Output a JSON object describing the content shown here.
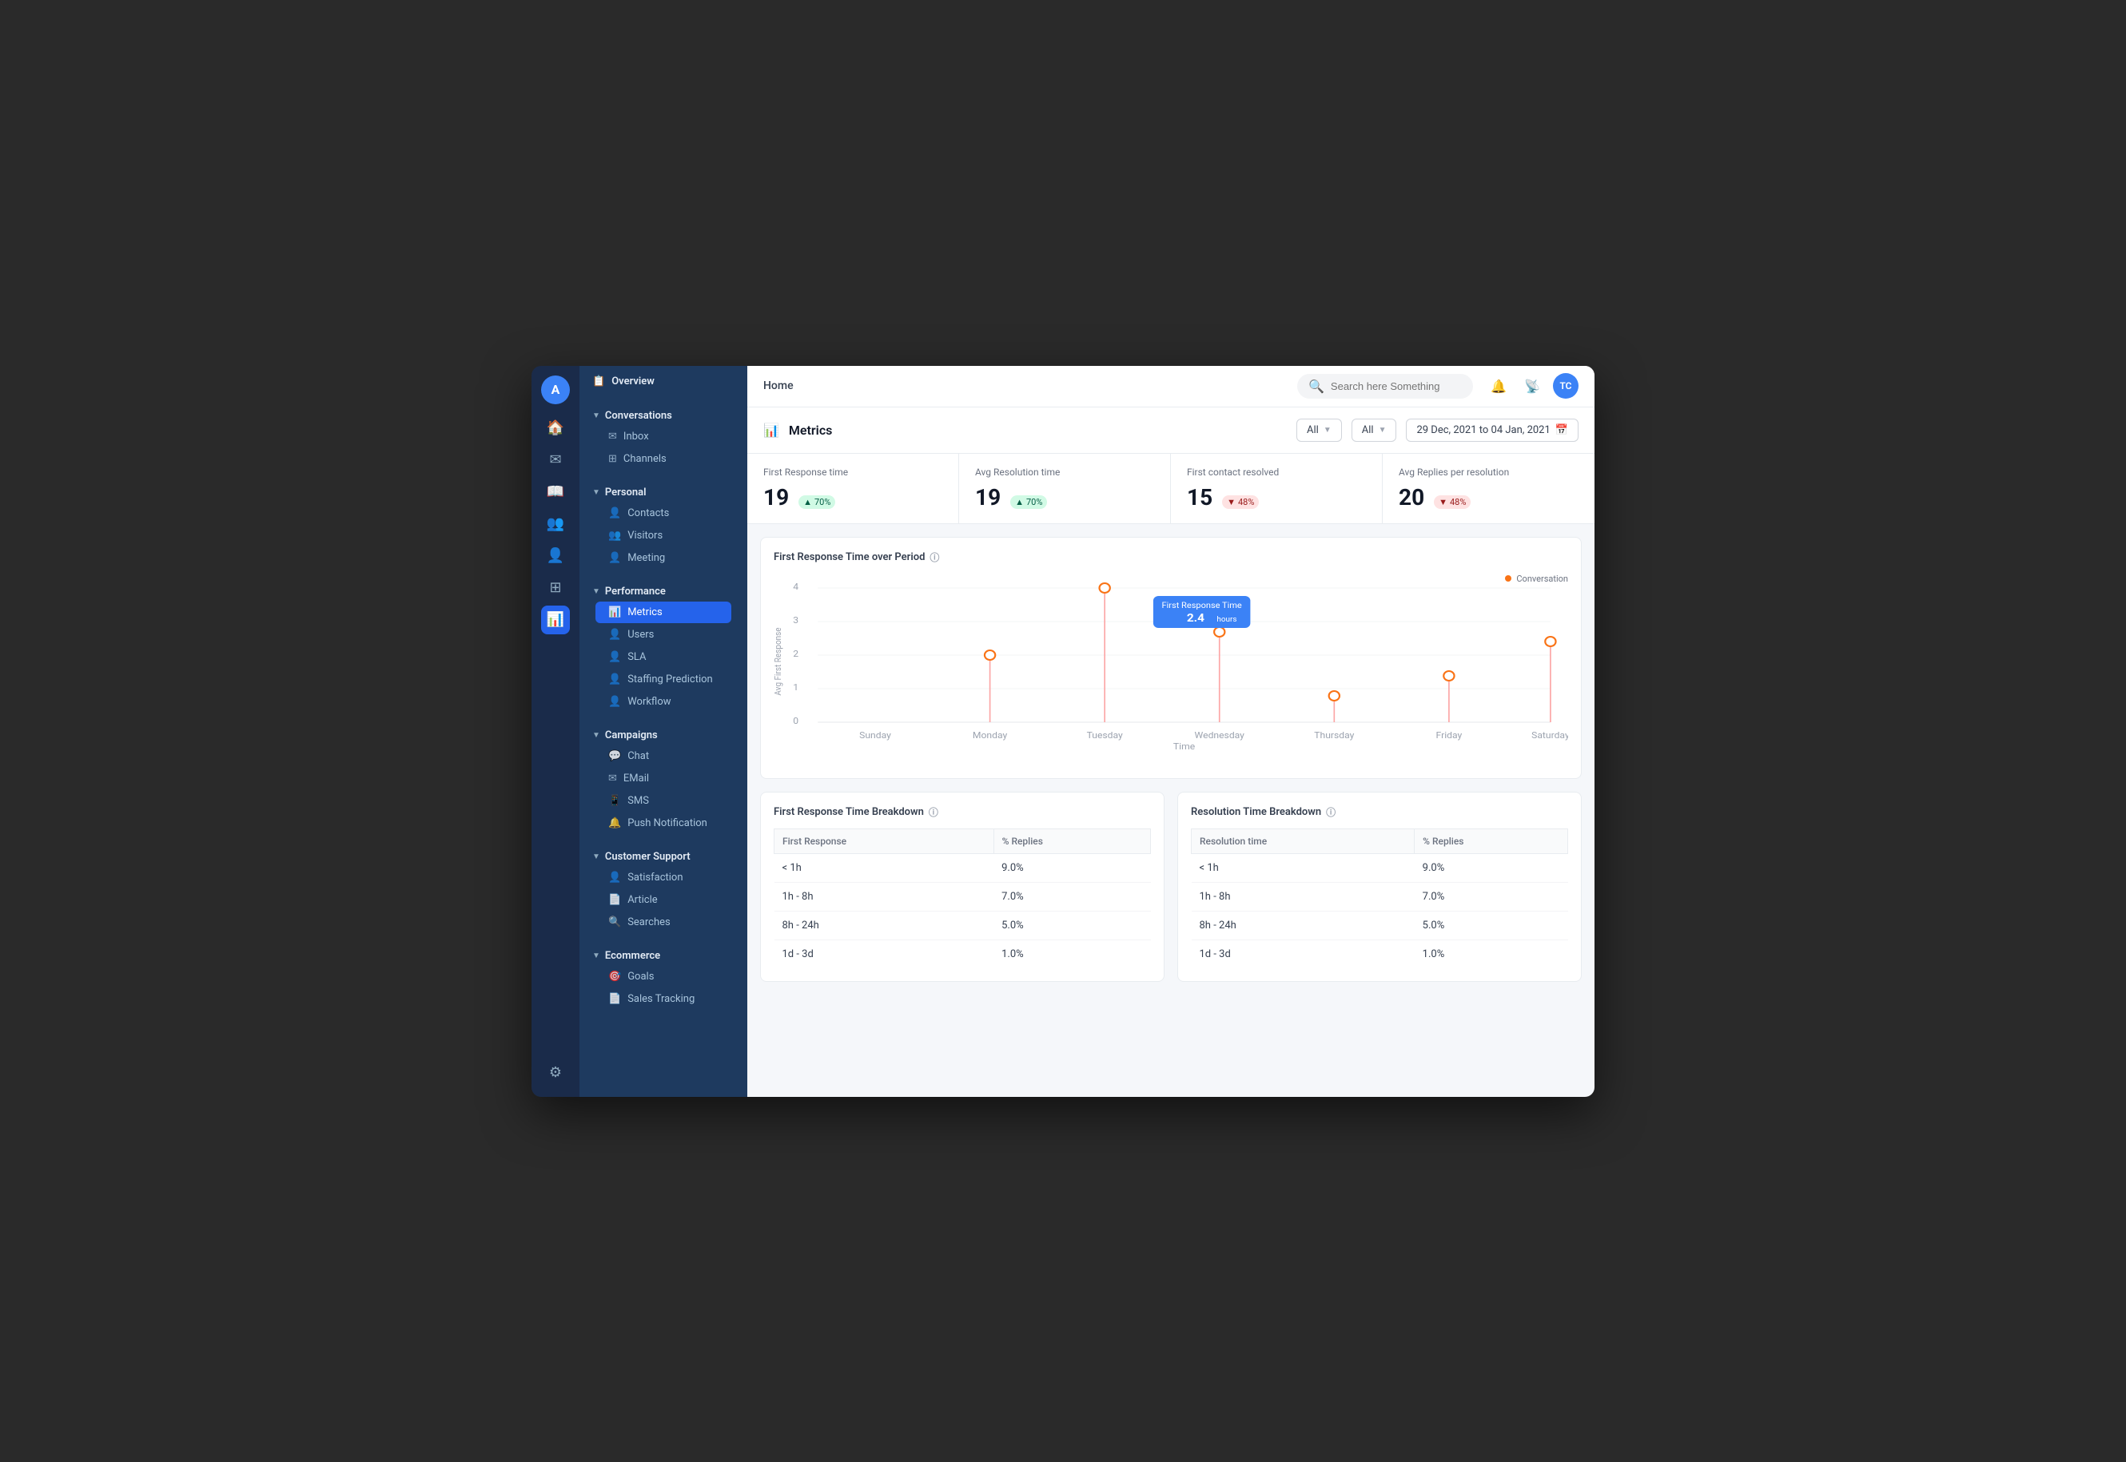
{
  "app": {
    "title": "Home",
    "logo": "A",
    "avatar": "TC"
  },
  "search": {
    "placeholder": "Search here Something"
  },
  "sidebar": {
    "overview_label": "Overview",
    "sections": [
      {
        "name": "Conversations",
        "items": [
          {
            "id": "inbox",
            "label": "Inbox",
            "icon": "✉"
          },
          {
            "id": "channels",
            "label": "Channels",
            "icon": "⊞"
          }
        ]
      },
      {
        "name": "Personal",
        "items": [
          {
            "id": "contacts",
            "label": "Contacts",
            "icon": "👤"
          },
          {
            "id": "visitors",
            "label": "Visitors",
            "icon": "👥"
          },
          {
            "id": "meeting",
            "label": "Meeting",
            "icon": "👤"
          }
        ]
      },
      {
        "name": "Performance",
        "items": [
          {
            "id": "metrics",
            "label": "Metrics",
            "icon": "📊",
            "active": true
          },
          {
            "id": "users",
            "label": "Users",
            "icon": "👤"
          },
          {
            "id": "sla",
            "label": "SLA",
            "icon": "👤"
          },
          {
            "id": "staffing",
            "label": "Staffing Prediction",
            "icon": "👤"
          },
          {
            "id": "workflow",
            "label": "Workflow",
            "icon": "👤"
          }
        ]
      },
      {
        "name": "Campaigns",
        "items": [
          {
            "id": "chat",
            "label": "Chat",
            "icon": "💬"
          },
          {
            "id": "email",
            "label": "EMail",
            "icon": "✉"
          },
          {
            "id": "sms",
            "label": "SMS",
            "icon": "📱"
          },
          {
            "id": "push",
            "label": "Push Notification",
            "icon": "🔔"
          }
        ]
      },
      {
        "name": "Customer Support",
        "items": [
          {
            "id": "satisfaction",
            "label": "Satisfaction",
            "icon": "👤"
          },
          {
            "id": "article",
            "label": "Article",
            "icon": "📄"
          },
          {
            "id": "searches",
            "label": "Searches",
            "icon": "🔍"
          }
        ]
      },
      {
        "name": "Ecommerce",
        "items": [
          {
            "id": "goals",
            "label": "Goals",
            "icon": "🎯"
          },
          {
            "id": "sales",
            "label": "Sales Tracking",
            "icon": "📄"
          }
        ]
      }
    ]
  },
  "metrics": {
    "title": "Metrics",
    "filters": {
      "filter1": "All",
      "filter2": "All",
      "date_range": "29 Dec, 2021 to 04 Jan, 2021"
    },
    "stats": [
      {
        "label": "First Response time",
        "value": "19",
        "badge": "70%",
        "badge_type": "up"
      },
      {
        "label": "Avg Resolution time",
        "value": "19",
        "badge": "70%",
        "badge_type": "up"
      },
      {
        "label": "First contact resolved",
        "value": "15",
        "badge": "48%",
        "badge_type": "down"
      },
      {
        "label": "Avg Replies per resolution",
        "value": "20",
        "badge": "48%",
        "badge_type": "down"
      }
    ],
    "chart": {
      "title": "First Response Time over Period",
      "y_label": "Avg First Response",
      "x_label": "Time",
      "legend": "Conversation",
      "tooltip": {
        "label": "First Response Time",
        "value": "2.4",
        "unit": "hours"
      },
      "days": [
        "Sunday",
        "Monday",
        "Tuesday",
        "Wednesday",
        "Thursday",
        "Friday",
        "Saturday"
      ],
      "values": [
        0,
        2,
        4,
        2.7,
        0.8,
        1.4,
        2.5,
        2.4
      ]
    },
    "first_response_breakdown": {
      "title": "First Response Time Breakdown",
      "col1": "First Response",
      "col2": "% Replies",
      "rows": [
        {
          "range": "< 1h",
          "pct": "9.0%"
        },
        {
          "range": "1h - 8h",
          "pct": "7.0%"
        },
        {
          "range": "8h - 24h",
          "pct": "5.0%"
        },
        {
          "range": "1d - 3d",
          "pct": "1.0%"
        }
      ]
    },
    "resolution_breakdown": {
      "title": "Resolution Time Breakdown",
      "col1": "Resolution time",
      "col2": "% Replies",
      "rows": [
        {
          "range": "< 1h",
          "pct": "9.0%"
        },
        {
          "range": "1h - 8h",
          "pct": "7.0%"
        },
        {
          "range": "8h - 24h",
          "pct": "5.0%"
        },
        {
          "range": "1d - 3d",
          "pct": "1.0%"
        }
      ]
    }
  }
}
